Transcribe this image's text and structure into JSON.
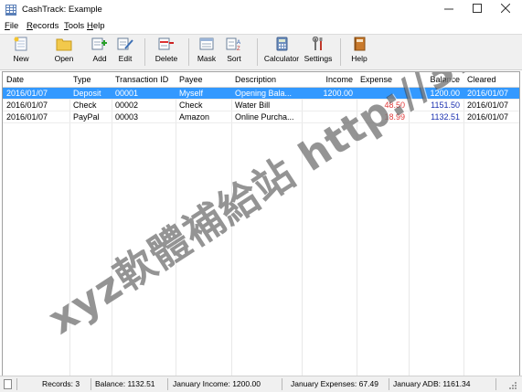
{
  "window": {
    "title": "CashTrack: Example"
  },
  "menu": [
    {
      "label": "File",
      "ul": "F",
      "rest": "ile"
    },
    {
      "label": "Records",
      "ul": "R",
      "rest": "ecords"
    },
    {
      "label": "Tools",
      "ul": "T",
      "rest": "ools"
    },
    {
      "label": "Help",
      "ul": "H",
      "rest": "elp"
    }
  ],
  "toolbar": {
    "new": "New",
    "open": "Open",
    "add": "Add",
    "edit": "Edit",
    "delete": "Delete",
    "mask": "Mask",
    "sort": "Sort",
    "calculator": "Calculator",
    "settings": "Settings",
    "help": "Help"
  },
  "columns": {
    "date": "Date",
    "type": "Type",
    "txid": "Transaction ID",
    "payee": "Payee",
    "description": "Description",
    "income": "Income",
    "expense": "Expense",
    "balance": "Balance",
    "cleared": "Cleared"
  },
  "rows": [
    {
      "date": "2016/01/07",
      "type": "Deposit",
      "txid": "00001",
      "payee": "Myself",
      "description": "Opening Bala...",
      "income": "1200.00",
      "expense": "",
      "balance": "1200.00",
      "cleared": "2016/01/07"
    },
    {
      "date": "2016/01/07",
      "type": "Check",
      "txid": "00002",
      "payee": "Check",
      "description": "Water Bill",
      "income": "",
      "expense": "48.50",
      "balance": "1151.50",
      "cleared": "2016/01/07"
    },
    {
      "date": "2016/01/07",
      "type": "PayPal",
      "txid": "00003",
      "payee": "Amazon",
      "description": "Online Purcha...",
      "income": "",
      "expense": "18.99",
      "balance": "1132.51",
      "cleared": "2016/01/07"
    }
  ],
  "status": {
    "records": "Records: 3",
    "balance": "Balance: 1132.51",
    "income": "January Income: 1200.00",
    "expenses": "January Expenses: 67.49",
    "adb": "January ADB: 1161.34"
  },
  "watermark": "xyz軟體補給站 http://31.to",
  "colors": {
    "selection": "#3399ff",
    "expense": "#e03a3a",
    "balance": "#1a2fb0"
  }
}
